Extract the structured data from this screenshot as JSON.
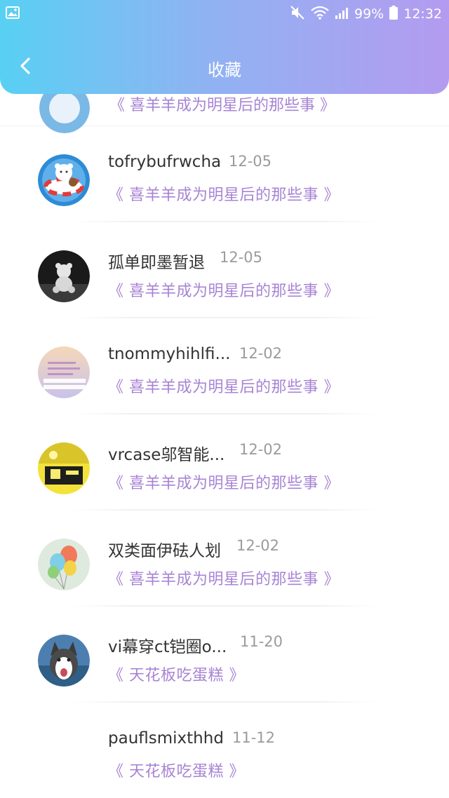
{
  "status_bar": {
    "battery": "99%",
    "time": "12:32",
    "icons": [
      "gallery-icon",
      "mute-icon",
      "wifi-icon",
      "signal-icon",
      "battery-icon"
    ]
  },
  "header": {
    "title": "收藏",
    "back_icon": "chevron-left-icon"
  },
  "partial_item": {
    "link": "《 喜羊羊成为明星后的那些事 》"
  },
  "items": [
    {
      "name": "tofrybufrwcha",
      "date": "12-05",
      "link": "《 喜羊羊成为明星后的那些事 》",
      "avatar": "bear-float-avatar"
    },
    {
      "name": "孤单即墨暂退",
      "date": "12-05",
      "link": "《 喜羊羊成为明星后的那些事 》",
      "avatar": "teddy-bear-avatar"
    },
    {
      "name": "tnommyhihlfi...",
      "date": "12-02",
      "link": "《 喜羊羊成为明星后的那些事 》",
      "avatar": "keyboard-avatar"
    },
    {
      "name": "vrcase邬智能...",
      "date": "12-02",
      "link": "《 喜羊羊成为明星后的那些事 》",
      "avatar": "yellow-room-avatar"
    },
    {
      "name": "双类面伊砝人划",
      "date": "12-02",
      "link": "《 喜羊羊成为明星后的那些事 》",
      "avatar": "balloons-avatar"
    },
    {
      "name": "vi幕穿ct铠圈o...",
      "date": "11-20",
      "link": "《 天花板吃蛋糕 》",
      "avatar": "husky-avatar"
    },
    {
      "name": "pauflsmixthhd",
      "date": "11-12",
      "link": "《 天花板吃蛋糕 》",
      "avatar": "none"
    }
  ],
  "colors": {
    "accent": "#a784d4",
    "header_start": "#58d0f3",
    "header_end": "#b49bf0"
  }
}
